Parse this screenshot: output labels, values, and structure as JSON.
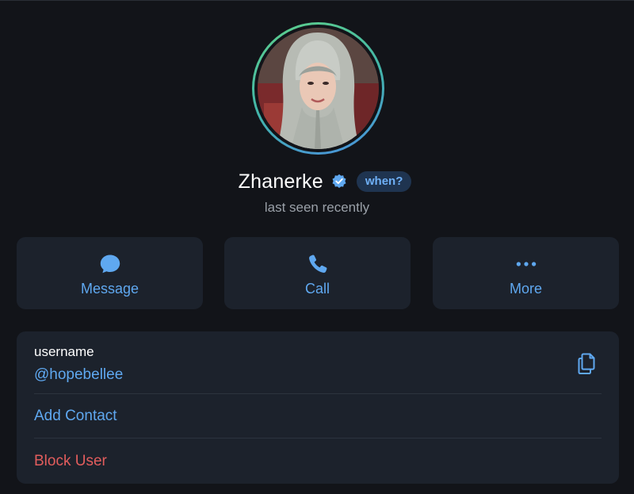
{
  "profile": {
    "name": "Zhanerke",
    "badge": "when?",
    "status": "last seen recently",
    "verified_icon": "verified-check-icon"
  },
  "actions": [
    {
      "label": "Message",
      "icon": "chat-bubble-icon"
    },
    {
      "label": "Call",
      "icon": "phone-icon"
    },
    {
      "label": "More",
      "icon": "more-dots-icon"
    }
  ],
  "info": {
    "username_label": "username",
    "username": "@hopebellee",
    "copy_icon": "copy-icon",
    "add_contact": "Add Contact",
    "block_user": "Block User"
  },
  "colors": {
    "background": "#121419",
    "card": "#1c222c",
    "accent": "#5fa8f0",
    "danger": "#e25d5d",
    "muted": "#9aa0a8"
  }
}
